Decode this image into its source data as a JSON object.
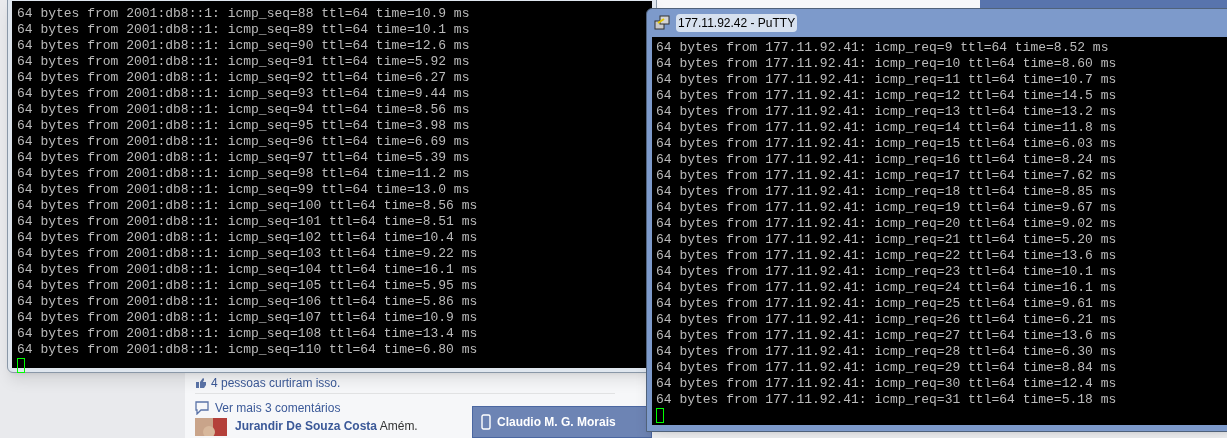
{
  "background_page": {
    "likes": "4 pessoas curtiram isso.",
    "more_comments": "Ver mais 3 comentários",
    "comment": {
      "author": "Jurandir De Souza Costa",
      "text": "Amém."
    },
    "chat_tab": {
      "name": "Claudio M. G. Morais"
    }
  },
  "left_terminal": {
    "cursor": true,
    "lines": [
      "64 bytes from 2001:db8::1: icmp_seq=88 ttl=64 time=10.9 ms",
      "64 bytes from 2001:db8::1: icmp_seq=89 ttl=64 time=10.1 ms",
      "64 bytes from 2001:db8::1: icmp_seq=90 ttl=64 time=12.6 ms",
      "64 bytes from 2001:db8::1: icmp_seq=91 ttl=64 time=5.92 ms",
      "64 bytes from 2001:db8::1: icmp_seq=92 ttl=64 time=6.27 ms",
      "64 bytes from 2001:db8::1: icmp_seq=93 ttl=64 time=9.44 ms",
      "64 bytes from 2001:db8::1: icmp_seq=94 ttl=64 time=8.56 ms",
      "64 bytes from 2001:db8::1: icmp_seq=95 ttl=64 time=3.98 ms",
      "64 bytes from 2001:db8::1: icmp_seq=96 ttl=64 time=6.69 ms",
      "64 bytes from 2001:db8::1: icmp_seq=97 ttl=64 time=5.39 ms",
      "64 bytes from 2001:db8::1: icmp_seq=98 ttl=64 time=11.2 ms",
      "64 bytes from 2001:db8::1: icmp_seq=99 ttl=64 time=13.0 ms",
      "64 bytes from 2001:db8::1: icmp_seq=100 ttl=64 time=8.56 ms",
      "64 bytes from 2001:db8::1: icmp_seq=101 ttl=64 time=8.51 ms",
      "64 bytes from 2001:db8::1: icmp_seq=102 ttl=64 time=10.4 ms",
      "64 bytes from 2001:db8::1: icmp_seq=103 ttl=64 time=9.22 ms",
      "64 bytes from 2001:db8::1: icmp_seq=104 ttl=64 time=16.1 ms",
      "64 bytes from 2001:db8::1: icmp_seq=105 ttl=64 time=5.95 ms",
      "64 bytes from 2001:db8::1: icmp_seq=106 ttl=64 time=5.86 ms",
      "64 bytes from 2001:db8::1: icmp_seq=107 ttl=64 time=10.9 ms",
      "64 bytes from 2001:db8::1: icmp_seq=108 ttl=64 time=13.4 ms",
      "64 bytes from 2001:db8::1: icmp_seq=110 ttl=64 time=6.80 ms"
    ]
  },
  "putty_window": {
    "title": "177.11.92.42 - PuTTY",
    "cursor": true,
    "lines": [
      "64 bytes from 177.11.92.41: icmp_req=9 ttl=64 time=8.52 ms",
      "64 bytes from 177.11.92.41: icmp_req=10 ttl=64 time=8.60 ms",
      "64 bytes from 177.11.92.41: icmp_req=11 ttl=64 time=10.7 ms",
      "64 bytes from 177.11.92.41: icmp_req=12 ttl=64 time=14.5 ms",
      "64 bytes from 177.11.92.41: icmp_req=13 ttl=64 time=13.2 ms",
      "64 bytes from 177.11.92.41: icmp_req=14 ttl=64 time=11.8 ms",
      "64 bytes from 177.11.92.41: icmp_req=15 ttl=64 time=6.03 ms",
      "64 bytes from 177.11.92.41: icmp_req=16 ttl=64 time=8.24 ms",
      "64 bytes from 177.11.92.41: icmp_req=17 ttl=64 time=7.62 ms",
      "64 bytes from 177.11.92.41: icmp_req=18 ttl=64 time=8.85 ms",
      "64 bytes from 177.11.92.41: icmp_req=19 ttl=64 time=9.67 ms",
      "64 bytes from 177.11.92.41: icmp_req=20 ttl=64 time=9.02 ms",
      "64 bytes from 177.11.92.41: icmp_req=21 ttl=64 time=5.20 ms",
      "64 bytes from 177.11.92.41: icmp_req=22 ttl=64 time=13.6 ms",
      "64 bytes from 177.11.92.41: icmp_req=23 ttl=64 time=10.1 ms",
      "64 bytes from 177.11.92.41: icmp_req=24 ttl=64 time=16.1 ms",
      "64 bytes from 177.11.92.41: icmp_req=25 ttl=64 time=9.61 ms",
      "64 bytes from 177.11.92.41: icmp_req=26 ttl=64 time=6.21 ms",
      "64 bytes from 177.11.92.41: icmp_req=27 ttl=64 time=13.6 ms",
      "64 bytes from 177.11.92.41: icmp_req=28 ttl=64 time=6.30 ms",
      "64 bytes from 177.11.92.41: icmp_req=29 ttl=64 time=8.84 ms",
      "64 bytes from 177.11.92.41: icmp_req=30 ttl=64 time=12.4 ms",
      "64 bytes from 177.11.92.41: icmp_req=31 ttl=64 time=5.18 ms"
    ]
  }
}
